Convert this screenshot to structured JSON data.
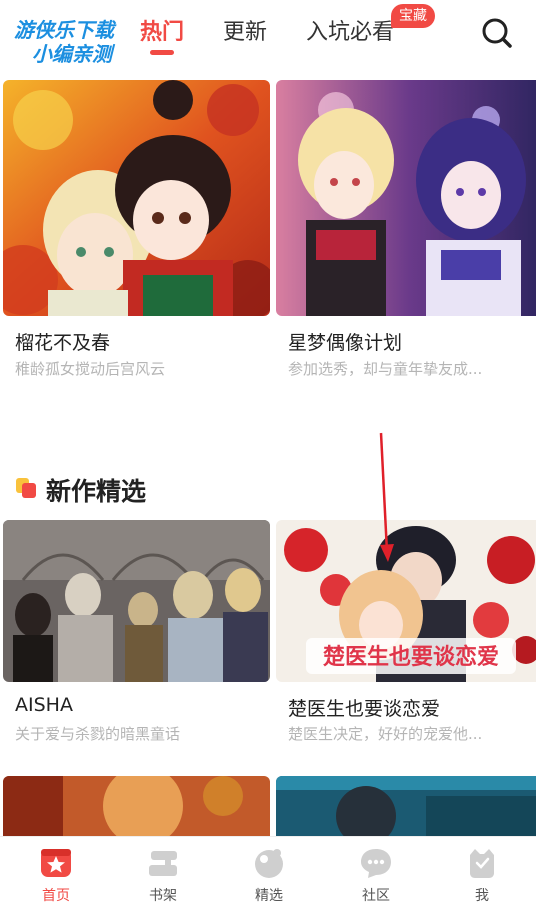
{
  "watermark": {
    "line1": "游侠乐下载",
    "line2": "小编亲测"
  },
  "top_tabs": [
    {
      "label": "热门",
      "active": true
    },
    {
      "label": "更新",
      "active": false
    },
    {
      "label": "入坑必看",
      "active": false,
      "badge": "宝藏"
    }
  ],
  "search": {
    "icon": "search-icon"
  },
  "section": {
    "title": "新作精选"
  },
  "cards": [
    {
      "title": "榴花不及春",
      "subtitle": "稚龄孤女搅动后宫风云"
    },
    {
      "title": "星梦偶像计划",
      "subtitle": "参加选秀，却与童年挚友成..."
    },
    {
      "title": "AISHA",
      "subtitle": "关于爱与杀戮的暗黑童话"
    },
    {
      "title": "楚医生也要谈恋爱",
      "subtitle": "楚医生决定，好好的宠爱他...",
      "cover_text": "楚医生也要谈恋爱"
    }
  ],
  "bottom_nav": [
    {
      "label": "首页",
      "icon": "home-icon",
      "active": true
    },
    {
      "label": "书架",
      "icon": "bookshelf-icon",
      "active": false
    },
    {
      "label": "精选",
      "icon": "featured-icon",
      "active": false
    },
    {
      "label": "社区",
      "icon": "community-icon",
      "active": false
    },
    {
      "label": "我",
      "icon": "profile-icon",
      "active": false
    }
  ],
  "colors": {
    "accent": "#f14a44",
    "subtitle": "#b5b5b5",
    "watermark": "#1c8fe0"
  }
}
